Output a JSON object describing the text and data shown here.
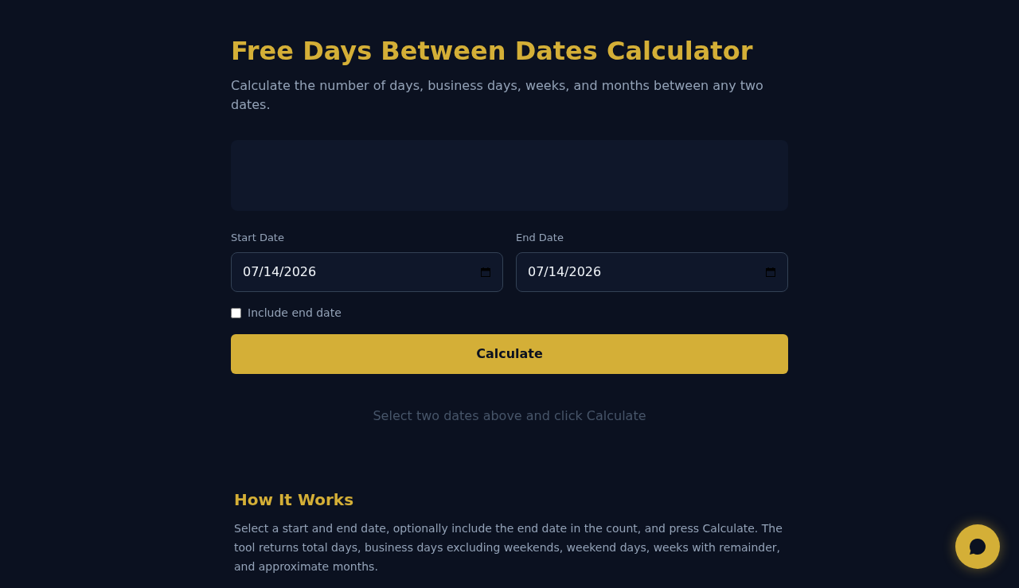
{
  "header": {
    "title": "Free Days Between Dates Calculator",
    "subtitle": "Calculate the number of days, business days, weeks, and months between any two dates."
  },
  "form": {
    "date_fields": [
      {
        "label": "Start Date",
        "value": "07/14/2026"
      },
      {
        "label": "End Date",
        "value": "07/14/2026"
      }
    ],
    "include_end_date": {
      "label": "Include end date",
      "checked": false
    },
    "calculate_button": "Calculate"
  },
  "result": {
    "message": "Select two dates above and click Calculate"
  },
  "how_it_works": {
    "title": "How It Works",
    "text": "Select a start and end date, optionally include the end date in the count, and press Calculate. The tool returns total days, business days excluding weekends, weekend days, weeks with remainder, and approximate months."
  }
}
